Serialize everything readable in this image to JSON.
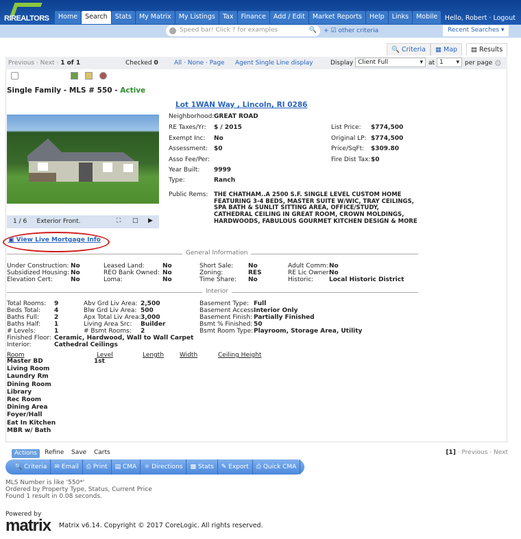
{
  "header": {
    "logo": "RIREALTORS",
    "nav": [
      "Home",
      "Search",
      "Stats",
      "My Matrix",
      "My Listings",
      "Tax",
      "Finance",
      "Add / Edit",
      "Market Reports",
      "Help",
      "Links",
      "Mobile"
    ],
    "active_nav": "Search",
    "greeting": "Hello, Robert · Logout"
  },
  "speedbar": {
    "placeholder": "Speed bar! Click ? for examples",
    "other_criteria": "other criteria",
    "recent_searches": "Recent Searches"
  },
  "view_tabs": [
    "Criteria",
    "Map",
    "Results"
  ],
  "toolbar": {
    "pager": "Previous · Next ·",
    "page_of": "1 of 1",
    "checked_label": "Checked",
    "checked_count": "0",
    "select": "All · None · Page",
    "agent_display": "Agent Single Line display",
    "display_label": "Display",
    "display_value": "Client Full",
    "at_label": "at",
    "per_page_value": "1",
    "per_page_label": "per page"
  },
  "listing": {
    "type": "Single Family - MLS # 550 -",
    "status": "Active",
    "status_color": "#2e8b2e",
    "address": "Lot 1WAN Way , Lincoln, RI 0286",
    "photo_counter": "1 / 6",
    "photo_caption": "Exterior Front.",
    "mortgage_link": "View Live Mortgage Info",
    "left_fields": [
      [
        "Neighborhood:",
        "GREAT ROAD"
      ],
      [
        "RE Taxes/Yr:",
        "$ / 2015"
      ],
      [
        "Exempt Inc:",
        "No"
      ],
      [
        "Assessment:",
        "$0"
      ],
      [
        "Asso Fee/Per:",
        ""
      ],
      [
        "Year Built:",
        "9999"
      ],
      [
        "Type:",
        "Ranch"
      ]
    ],
    "right_fields": [
      [
        "List Price:",
        "$774,500"
      ],
      [
        "Original LP:",
        "$774,500"
      ],
      [
        "Price/SqFt:",
        "$309.80"
      ],
      [
        "Fire Dist Tax:",
        "$0"
      ]
    ],
    "public_rems_label": "Public Rems:",
    "public_rems": [
      "THE CHATHAM..A 2500 S.F. SINGLE LEVEL CUSTOM HOME",
      "FEATURING 3-4 BEDS, MASTER SUITE W/WIC, TRAY CEILINGS,",
      "SPA BATH & SUNLIT SITTING AREA, OFFICE/STUDY,",
      "CATHEDRAL CEILING IN GREAT ROOM, CROWN MOLDINGS,",
      "HARDWOODS, FABULOUS GOURMET KITCHEN DESIGN & MORE"
    ]
  },
  "general": {
    "title": "General Information",
    "cols": [
      [
        [
          "Under Construction:",
          "No"
        ],
        [
          "Subsidized Housing:",
          "No"
        ],
        [
          "Elevation Cert:",
          "No"
        ]
      ],
      [
        [
          "Leased Land:",
          "No"
        ],
        [
          "REO Bank Owned:",
          "No"
        ],
        [
          "Loma:",
          "No"
        ]
      ],
      [
        [
          "Short Sale:",
          "No"
        ],
        [
          "Zoning:",
          "RES"
        ],
        [
          "Time Share:",
          "No"
        ]
      ],
      [
        [
          "Adult Comm:",
          "No"
        ],
        [
          "RE Lic Owner:",
          "No"
        ],
        [
          "Historic:",
          "Local Historic District"
        ]
      ]
    ]
  },
  "interior": {
    "title": "Interior",
    "cols": [
      [
        [
          "Total Rooms:",
          "9"
        ],
        [
          "Beds Total:",
          "4"
        ],
        [
          "Baths Full:",
          "2"
        ],
        [
          "Baths Half:",
          "1"
        ],
        [
          "# Levels:",
          "1"
        ]
      ],
      [
        [
          "Abv Grd Liv Area:",
          "2,500"
        ],
        [
          "Blw Grd Liv Area:",
          "500"
        ],
        [
          "Apx Total Liv Area:",
          "3,000"
        ],
        [
          "Living Area Src:",
          "Builder"
        ],
        [
          "# Bsmt Rooms:",
          "2"
        ]
      ],
      [
        [
          "Basement Type:",
          "Full"
        ],
        [
          "Basement Access:",
          "Interior Only"
        ],
        [
          "Basement Finish:",
          "Partially Finished"
        ],
        [
          "Bsmt % Finished:",
          "50"
        ],
        [
          "Bsmt Room Type:",
          "Playroom, Storage Area, Utility"
        ]
      ]
    ],
    "wide": [
      [
        "Finished Floor:",
        "Ceramic, Hardwood, Wall to Wall Carpet"
      ],
      [
        "Interior:",
        "Cathedral Ceilings"
      ]
    ]
  },
  "rooms": {
    "headers": [
      "Room",
      "Level",
      "Length",
      "Width",
      "Ceiling Height"
    ],
    "rows": [
      [
        "Master BD",
        "1st"
      ],
      [
        "Living Room",
        ""
      ],
      [
        "Laundry Rm",
        ""
      ],
      [
        "Dining Room",
        ""
      ],
      [
        "Library",
        ""
      ],
      [
        "Rec Room",
        ""
      ],
      [
        "Dining Area",
        ""
      ],
      [
        "Foyer/Hall",
        ""
      ],
      [
        "Eat In Kitchen",
        ""
      ],
      [
        "MBR w/ Bath",
        ""
      ]
    ]
  },
  "actions": {
    "tabs": [
      "Actions",
      "Refine",
      "Save",
      "Carts"
    ],
    "buttons": [
      "Criteria",
      "Email",
      "Print",
      "CMA",
      "Directions",
      "Stats",
      "Export",
      "Quick CMA"
    ],
    "pager_current": "[1]",
    "pager_links": "· Previous · Next"
  },
  "footer": {
    "criteria": [
      "MLS Number is like '550*'",
      "Ordered by Property Type, Status, Current Price",
      "Found 1 result in 0.08 seconds."
    ],
    "powered_by": "Powered by",
    "brand": "matrix",
    "copyright": "Matrix v6.14. Copyright © 2017 CoreLogic. All rights reserved."
  }
}
